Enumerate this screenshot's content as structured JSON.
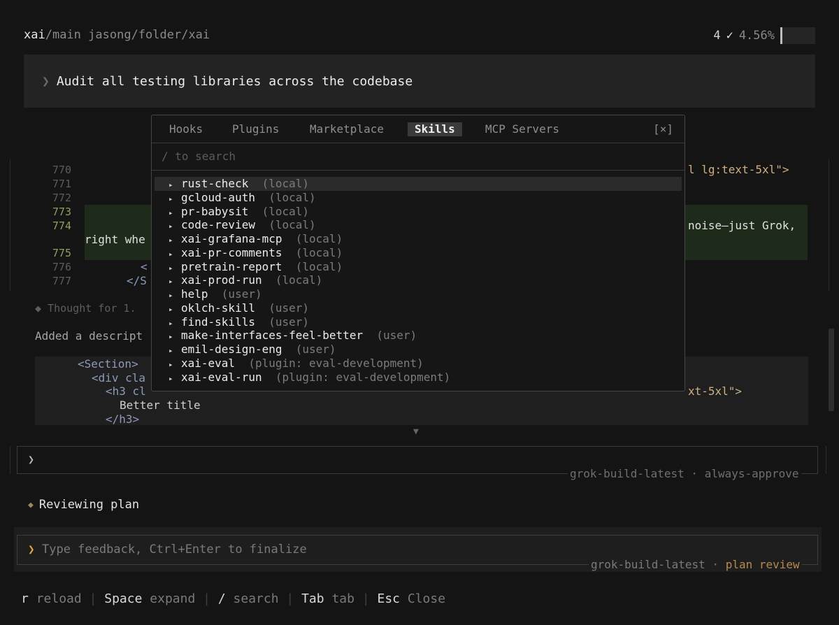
{
  "header": {
    "repo": "xai",
    "branch": "/main",
    "path": "jasong/folder/xai",
    "count": "4",
    "check_icon": "check-icon",
    "percent": "4.56%",
    "context_fraction": 0.0456
  },
  "prompt": {
    "chevron": "❯",
    "text": "Audit all testing libraries across the codebase"
  },
  "transcript": {
    "line_numbers": [
      "770",
      "771",
      "772",
      "773",
      "774",
      "775",
      "776",
      "777"
    ],
    "snip_770_right": "l lg:text-5xl\">",
    "snip_774_right": "noise—just Grok,",
    "snip_774_wrap": "right whe",
    "snip_776": "<",
    "snip_777": "</S",
    "thought": "◆ Thought for 1.",
    "added": "Added a descript",
    "code_lines": [
      "<Section>",
      "<div cla",
      "<h3 cl",
      "Better title",
      "</h3>"
    ],
    "code_h3_right": "xt-5xl\">",
    "scroll_down_icon": "▼"
  },
  "modal": {
    "tabs": [
      "Hooks",
      "Plugins",
      "Marketplace",
      "Skills",
      "MCP Servers"
    ],
    "active_tab": "Skills",
    "close_label": "[×]",
    "search_placeholder": "/ to search",
    "bullet": "▸",
    "skills": [
      {
        "name": "rust-check",
        "source": "(local)"
      },
      {
        "name": "gcloud-auth",
        "source": "(local)"
      },
      {
        "name": "pr-babysit",
        "source": "(local)"
      },
      {
        "name": "code-review",
        "source": "(local)"
      },
      {
        "name": "xai-grafana-mcp",
        "source": "(local)"
      },
      {
        "name": "xai-pr-comments",
        "source": "(local)"
      },
      {
        "name": "pretrain-report",
        "source": "(local)"
      },
      {
        "name": "xai-prod-run",
        "source": "(local)"
      },
      {
        "name": "help",
        "source": "(user)"
      },
      {
        "name": "oklch-skill",
        "source": "(user)"
      },
      {
        "name": "find-skills",
        "source": "(user)"
      },
      {
        "name": "make-interfaces-feel-better",
        "source": "(user)"
      },
      {
        "name": "emil-design-eng",
        "source": "(user)"
      },
      {
        "name": "xai-eval",
        "source": "(plugin: eval-development)"
      },
      {
        "name": "xai-eval-run",
        "source": "(plugin: eval-development)"
      }
    ]
  },
  "command": {
    "chevron": "❯",
    "model": "grok-build-latest",
    "separator": "·",
    "mode": "always-approve"
  },
  "status": {
    "icon": "◆",
    "text": "Reviewing plan"
  },
  "feedback": {
    "chevron": "❯",
    "placeholder": "Type feedback, Ctrl+Enter to finalize",
    "model": "grok-build-latest",
    "separator": "·",
    "mode": "plan review"
  },
  "footer": [
    {
      "key": "r",
      "action": "reload"
    },
    {
      "key": "Space",
      "action": "expand"
    },
    {
      "key": "/",
      "action": "search"
    },
    {
      "key": "Tab",
      "action": "tab"
    },
    {
      "key": "Esc",
      "action": "Close"
    }
  ]
}
